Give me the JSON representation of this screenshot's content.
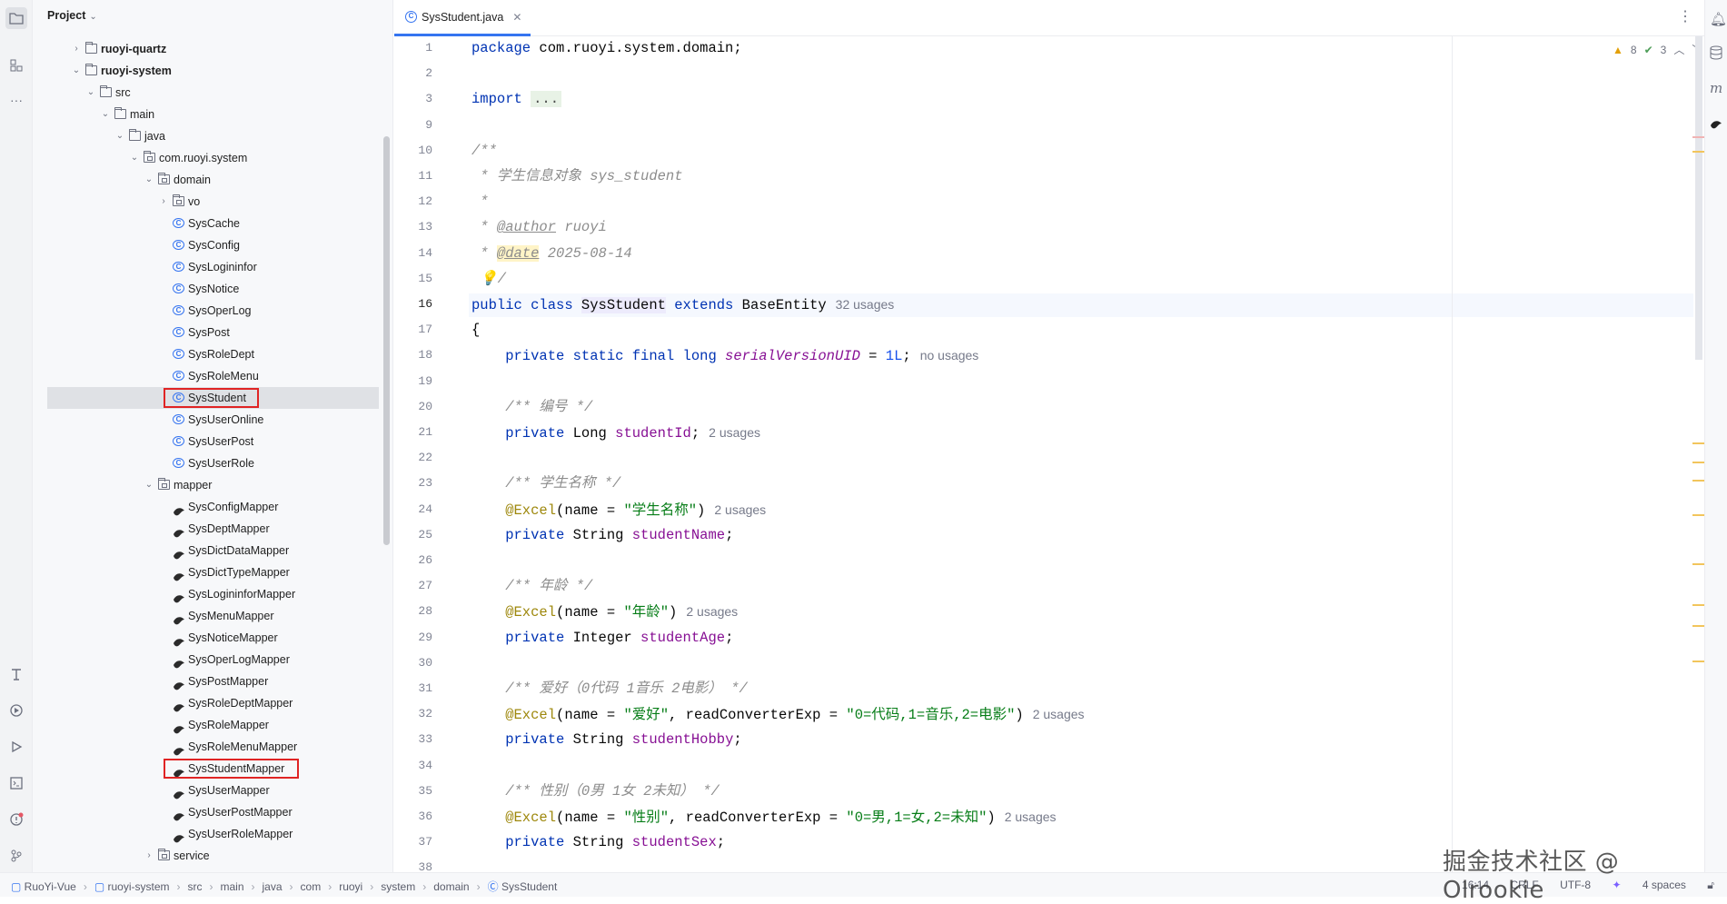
{
  "project_panel": {
    "title": "Project",
    "tree": [
      {
        "label": "ruoyi-quartz",
        "indent": 1,
        "arrow": "›",
        "icon": "module",
        "bold": true
      },
      {
        "label": "ruoyi-system",
        "indent": 1,
        "arrow": "⌄",
        "icon": "module",
        "bold": true
      },
      {
        "label": "src",
        "indent": 2,
        "arrow": "⌄",
        "icon": "folder"
      },
      {
        "label": "main",
        "indent": 3,
        "arrow": "⌄",
        "icon": "folder"
      },
      {
        "label": "java",
        "indent": 4,
        "arrow": "⌄",
        "icon": "folder"
      },
      {
        "label": "com.ruoyi.system",
        "indent": 5,
        "arrow": "⌄",
        "icon": "package"
      },
      {
        "label": "domain",
        "indent": 6,
        "arrow": "⌄",
        "icon": "package"
      },
      {
        "label": "vo",
        "indent": 7,
        "arrow": "›",
        "icon": "package"
      },
      {
        "label": "SysCache",
        "indent": 7,
        "icon": "class"
      },
      {
        "label": "SysConfig",
        "indent": 7,
        "icon": "class"
      },
      {
        "label": "SysLogininfor",
        "indent": 7,
        "icon": "class"
      },
      {
        "label": "SysNotice",
        "indent": 7,
        "icon": "class"
      },
      {
        "label": "SysOperLog",
        "indent": 7,
        "icon": "class"
      },
      {
        "label": "SysPost",
        "indent": 7,
        "icon": "class"
      },
      {
        "label": "SysRoleDept",
        "indent": 7,
        "icon": "class"
      },
      {
        "label": "SysRoleMenu",
        "indent": 7,
        "icon": "class"
      },
      {
        "label": "SysStudent",
        "indent": 7,
        "icon": "class",
        "selected": true,
        "highlight": true
      },
      {
        "label": "SysUserOnline",
        "indent": 7,
        "icon": "class"
      },
      {
        "label": "SysUserPost",
        "indent": 7,
        "icon": "class"
      },
      {
        "label": "SysUserRole",
        "indent": 7,
        "icon": "class"
      },
      {
        "label": "mapper",
        "indent": 6,
        "arrow": "⌄",
        "icon": "package"
      },
      {
        "label": "SysConfigMapper",
        "indent": 7,
        "icon": "mybatis"
      },
      {
        "label": "SysDeptMapper",
        "indent": 7,
        "icon": "mybatis"
      },
      {
        "label": "SysDictDataMapper",
        "indent": 7,
        "icon": "mybatis"
      },
      {
        "label": "SysDictTypeMapper",
        "indent": 7,
        "icon": "mybatis"
      },
      {
        "label": "SysLogininforMapper",
        "indent": 7,
        "icon": "mybatis"
      },
      {
        "label": "SysMenuMapper",
        "indent": 7,
        "icon": "mybatis"
      },
      {
        "label": "SysNoticeMapper",
        "indent": 7,
        "icon": "mybatis"
      },
      {
        "label": "SysOperLogMapper",
        "indent": 7,
        "icon": "mybatis"
      },
      {
        "label": "SysPostMapper",
        "indent": 7,
        "icon": "mybatis"
      },
      {
        "label": "SysRoleDeptMapper",
        "indent": 7,
        "icon": "mybatis"
      },
      {
        "label": "SysRoleMapper",
        "indent": 7,
        "icon": "mybatis"
      },
      {
        "label": "SysRoleMenuMapper",
        "indent": 7,
        "icon": "mybatis"
      },
      {
        "label": "SysStudentMapper",
        "indent": 7,
        "icon": "mybatis",
        "highlight": true
      },
      {
        "label": "SysUserMapper",
        "indent": 7,
        "icon": "mybatis"
      },
      {
        "label": "SysUserPostMapper",
        "indent": 7,
        "icon": "mybatis"
      },
      {
        "label": "SysUserRoleMapper",
        "indent": 7,
        "icon": "mybatis"
      },
      {
        "label": "service",
        "indent": 6,
        "arrow": "›",
        "icon": "package"
      }
    ]
  },
  "editor": {
    "tab_label": "SysStudent.java",
    "inspection": {
      "warnings": "8",
      "checks": "3"
    },
    "current_line": "16",
    "lines": [
      {
        "n": "1",
        "segs": [
          [
            "kw",
            "package "
          ],
          [
            "",
            "com.ruoyi.system.domain;"
          ]
        ]
      },
      {
        "n": "2",
        "segs": []
      },
      {
        "n": "3",
        "fold": true,
        "segs": [
          [
            "kw",
            "import "
          ],
          [
            "dots",
            "..."
          ]
        ]
      },
      {
        "n": "9",
        "segs": []
      },
      {
        "n": "10",
        "segs": [
          [
            "cmt",
            "/**"
          ]
        ]
      },
      {
        "n": "11",
        "segs": [
          [
            "cmt",
            " * 学生信息对象 sys_student"
          ]
        ]
      },
      {
        "n": "12",
        "segs": [
          [
            "cmt",
            " *"
          ]
        ]
      },
      {
        "n": "13",
        "segs": [
          [
            "cmt",
            " * "
          ],
          [
            "tag",
            "@author"
          ],
          [
            "cmt",
            " ruoyi"
          ]
        ]
      },
      {
        "n": "14",
        "segs": [
          [
            "cmt",
            " * "
          ],
          [
            "tag2",
            "@date"
          ],
          [
            "cmt",
            " 2025-08-14"
          ]
        ]
      },
      {
        "n": "15",
        "segs": [
          [
            "cmt",
            " 💡/"
          ]
        ]
      },
      {
        "n": "16",
        "segs": [
          [
            "kw",
            "public class "
          ],
          [
            "caret",
            ""
          ],
          [
            "clsname",
            "SysStudent"
          ],
          [
            "kw",
            " extends "
          ],
          [
            "",
            "BaseEntity"
          ],
          [
            "hint",
            "32 usages"
          ]
        ]
      },
      {
        "n": "17",
        "segs": [
          [
            "",
            "{"
          ]
        ]
      },
      {
        "n": "18",
        "segs": [
          [
            "kw",
            "    private static final long "
          ],
          [
            "sfld",
            "serialVersionUID"
          ],
          [
            "",
            " = "
          ],
          [
            "num",
            "1L"
          ],
          [
            "",
            ";"
          ],
          [
            "hint",
            "no usages"
          ]
        ]
      },
      {
        "n": "19",
        "segs": []
      },
      {
        "n": "20",
        "segs": [
          [
            "cmt",
            "    /** 编号 */"
          ]
        ]
      },
      {
        "n": "21",
        "segs": [
          [
            "kw",
            "    private "
          ],
          [
            "",
            "Long "
          ],
          [
            "fld",
            "studentId"
          ],
          [
            "",
            ";"
          ],
          [
            "hint",
            "2 usages"
          ]
        ]
      },
      {
        "n": "22",
        "segs": []
      },
      {
        "n": "23",
        "segs": [
          [
            "cmt",
            "    /** 学生名称 */"
          ]
        ]
      },
      {
        "n": "24",
        "segs": [
          [
            "ann",
            "    @Excel"
          ],
          [
            "",
            "(name = "
          ],
          [
            "str",
            "\"学生名称\""
          ],
          [
            "",
            ")"
          ],
          [
            "hint",
            "2 usages"
          ]
        ]
      },
      {
        "n": "25",
        "segs": [
          [
            "kw",
            "    private "
          ],
          [
            "",
            "String "
          ],
          [
            "fld",
            "studentName"
          ],
          [
            "",
            ";"
          ]
        ]
      },
      {
        "n": "26",
        "segs": []
      },
      {
        "n": "27",
        "segs": [
          [
            "cmt",
            "    /** 年龄 */"
          ]
        ]
      },
      {
        "n": "28",
        "segs": [
          [
            "ann",
            "    @Excel"
          ],
          [
            "",
            "(name = "
          ],
          [
            "str",
            "\"年龄\""
          ],
          [
            "",
            ")"
          ],
          [
            "hint",
            "2 usages"
          ]
        ]
      },
      {
        "n": "29",
        "segs": [
          [
            "kw",
            "    private "
          ],
          [
            "",
            "Integer "
          ],
          [
            "fld",
            "studentAge"
          ],
          [
            "",
            ";"
          ]
        ]
      },
      {
        "n": "30",
        "segs": []
      },
      {
        "n": "31",
        "segs": [
          [
            "cmt",
            "    /** 爱好（0代码 1音乐 2电影） */"
          ]
        ]
      },
      {
        "n": "32",
        "segs": [
          [
            "ann",
            "    @Excel"
          ],
          [
            "",
            "(name = "
          ],
          [
            "str",
            "\"爱好\""
          ],
          [
            "",
            ", readConverterExp = "
          ],
          [
            "str",
            "\"0=代码,1=音乐,2=电影\""
          ],
          [
            "",
            ")"
          ],
          [
            "hint",
            "2 usages"
          ]
        ]
      },
      {
        "n": "33",
        "segs": [
          [
            "kw",
            "    private "
          ],
          [
            "",
            "String "
          ],
          [
            "fld",
            "studentHobby"
          ],
          [
            "",
            ";"
          ]
        ]
      },
      {
        "n": "34",
        "segs": []
      },
      {
        "n": "35",
        "segs": [
          [
            "cmt",
            "    /** 性别（0男 1女 2未知） */"
          ]
        ]
      },
      {
        "n": "36",
        "segs": [
          [
            "ann",
            "    @Excel"
          ],
          [
            "",
            "(name = "
          ],
          [
            "str",
            "\"性别\""
          ],
          [
            "",
            ", readConverterExp = "
          ],
          [
            "str",
            "\"0=男,1=女,2=未知\""
          ],
          [
            "",
            ")"
          ],
          [
            "hint",
            "2 usages"
          ]
        ]
      },
      {
        "n": "37",
        "segs": [
          [
            "kw",
            "    private "
          ],
          [
            "",
            "String "
          ],
          [
            "fld",
            "studentSex"
          ],
          [
            "",
            ";"
          ]
        ]
      },
      {
        "n": "38",
        "segs": []
      }
    ]
  },
  "status_bar": {
    "breadcrumb": [
      "RuoYi-Vue",
      "ruoyi-system",
      "src",
      "main",
      "java",
      "com",
      "ruoyi",
      "system",
      "domain",
      "SysStudent"
    ],
    "position": "16:14",
    "line_sep": "CRLF",
    "encoding": "UTF-8",
    "indent": "4 spaces"
  },
  "watermark": "掘金技术社区 @ Olrookie",
  "colors": {
    "accent": "#3574f0",
    "highlight_box": "#e02424",
    "selection": "#dfe1e5"
  }
}
